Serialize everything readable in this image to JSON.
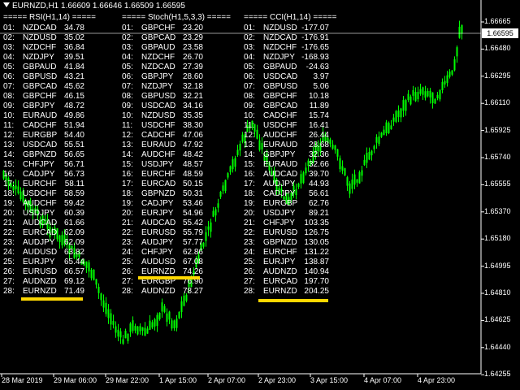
{
  "title": "EURNZD,H1  1.66609 1.66646 1.66509 1.66595",
  "columns": [
    {
      "header": "===== RSI(H1,14) =====",
      "rows": [
        [
          "01:",
          "NZDCAD",
          "34.78"
        ],
        [
          "02:",
          "NZDUSD",
          "35.02"
        ],
        [
          "03:",
          "NZDCHF",
          "36.84"
        ],
        [
          "04:",
          "NZDJPY",
          "39.51"
        ],
        [
          "05:",
          "GBPAUD",
          "41.84"
        ],
        [
          "06:",
          "GBPUSD",
          "43.21"
        ],
        [
          "07:",
          "GBPCAD",
          "45.62"
        ],
        [
          "08:",
          "GBPCHF",
          "46.15"
        ],
        [
          "09:",
          "GBPJPY",
          "48.72"
        ],
        [
          "10:",
          "EURAUD",
          "49.86"
        ],
        [
          "11:",
          "CADCHF",
          "51.94"
        ],
        [
          "12:",
          "EURGBP",
          "54.40"
        ],
        [
          "13:",
          "USDCAD",
          "55.51"
        ],
        [
          "14:",
          "GBPNZD",
          "56.65"
        ],
        [
          "15:",
          "CHFJPY",
          "56.71"
        ],
        [
          "16:",
          "CADJPY",
          "56.73"
        ],
        [
          "17:",
          "EURCHF",
          "58.11"
        ],
        [
          "18:",
          "USDCHF",
          "58.59"
        ],
        [
          "19:",
          "AUDCHF",
          "59.42"
        ],
        [
          "20:",
          "USDJPY",
          "60.39"
        ],
        [
          "21:",
          "AUDCAD",
          "61.66"
        ],
        [
          "22:",
          "EURCAD",
          "62.09"
        ],
        [
          "23:",
          "AUDJPY",
          "62.09"
        ],
        [
          "24:",
          "AUDUSD",
          "63.82"
        ],
        [
          "25:",
          "EURJPY",
          "65.44"
        ],
        [
          "26:",
          "EURUSD",
          "66.57"
        ],
        [
          "27:",
          "AUDNZD",
          "69.12"
        ],
        [
          "28:",
          "EURNZD",
          "71.49"
        ]
      ]
    },
    {
      "header": "===== Stoch(H1,5,3,3) =====",
      "rows": [
        [
          "01:",
          "GBPCHF",
          "23.20"
        ],
        [
          "02:",
          "GBPCAD",
          "23.29"
        ],
        [
          "03:",
          "GBPAUD",
          "23.58"
        ],
        [
          "04:",
          "NZDCHF",
          "26.70"
        ],
        [
          "05:",
          "NZDCAD",
          "27.39"
        ],
        [
          "06:",
          "GBPJPY",
          "28.60"
        ],
        [
          "07:",
          "NZDJPY",
          "32.18"
        ],
        [
          "08:",
          "GBPUSD",
          "32.21"
        ],
        [
          "09:",
          "USDCAD",
          "34.16"
        ],
        [
          "10:",
          "NZDUSD",
          "35.35"
        ],
        [
          "11:",
          "USDCHF",
          "38.30"
        ],
        [
          "12:",
          "CADCHF",
          "47.06"
        ],
        [
          "13:",
          "EURAUD",
          "47.92"
        ],
        [
          "14:",
          "AUDCHF",
          "48.42"
        ],
        [
          "15:",
          "USDJPY",
          "48.57"
        ],
        [
          "16:",
          "EURCHF",
          "48.59"
        ],
        [
          "17:",
          "EURCAD",
          "50.15"
        ],
        [
          "18:",
          "GBPNZD",
          "50.31"
        ],
        [
          "19:",
          "CADJPY",
          "53.46"
        ],
        [
          "20:",
          "EURJPY",
          "54.96"
        ],
        [
          "21:",
          "AUDCAD",
          "55.42"
        ],
        [
          "22:",
          "EURUSD",
          "55.79"
        ],
        [
          "23:",
          "AUDJPY",
          "57.77"
        ],
        [
          "24:",
          "CHFJPY",
          "62.86"
        ],
        [
          "25:",
          "AUDUSD",
          "67.08"
        ],
        [
          "26:",
          "EURNZD",
          "74.26"
        ],
        [
          "27:",
          "EURGBP",
          "76.90"
        ],
        [
          "28:",
          "AUDNZD",
          "78.27"
        ]
      ]
    },
    {
      "header": "===== CCI(H1,14) =====",
      "rows": [
        [
          "01:",
          "NZDUSD",
          "-177.07"
        ],
        [
          "02:",
          "NZDCAD",
          "-176.91"
        ],
        [
          "03:",
          "NZDCHF",
          "-176.65"
        ],
        [
          "04:",
          "NZDJPY",
          "-168.93"
        ],
        [
          "05:",
          "GBPAUD",
          "-24.63"
        ],
        [
          "06:",
          "USDCAD",
          "3.97"
        ],
        [
          "07:",
          "GBPUSD",
          "5.06"
        ],
        [
          "08:",
          "GBPCHF",
          "10.18"
        ],
        [
          "09:",
          "GBPCAD",
          "11.89"
        ],
        [
          "10:",
          "CADCHF",
          "15.74"
        ],
        [
          "11:",
          "USDCHF",
          "16.41"
        ],
        [
          "12:",
          "AUDCHF",
          "26.44"
        ],
        [
          "13:",
          "EURAUD",
          "28.68"
        ],
        [
          "14:",
          "GBPJPY",
          "32.36"
        ],
        [
          "15:",
          "EURAUD",
          "32.66"
        ],
        [
          "16:",
          "AUDCAD",
          "39.70"
        ],
        [
          "17:",
          "AUDJPY",
          "44.93"
        ],
        [
          "18:",
          "CADJPY",
          "56.61"
        ],
        [
          "19:",
          "EURGBP",
          "62.76"
        ],
        [
          "20:",
          "USDJPY",
          "89.21"
        ],
        [
          "21:",
          "CHFJPY",
          "103.35"
        ],
        [
          "22:",
          "EURUSD",
          "126.75"
        ],
        [
          "23:",
          "GBPNZD",
          "130.05"
        ],
        [
          "24:",
          "EURCHF",
          "131.22"
        ],
        [
          "25:",
          "EURJPY",
          "138.87"
        ],
        [
          "26:",
          "AUDNZD",
          "140.94"
        ],
        [
          "27:",
          "EURCAD",
          "197.70"
        ],
        [
          "28:",
          "EURNZD",
          "204.25"
        ]
      ]
    }
  ],
  "price_axis": [
    "1.66665",
    "1.66480",
    "1.66295",
    "1.66110",
    "1.65925",
    "1.65740",
    "1.65555",
    "1.65370",
    "1.65180",
    "1.64995",
    "1.64810",
    "1.64625",
    "1.64440",
    "1.64255"
  ],
  "current_price": "1.66595",
  "time_axis": [
    "28 Mar 2019",
    "29 Mar 06:00",
    "29 Mar 22:00",
    "1 Apr 15:00",
    "2 Apr 07:00",
    "2 Apr 23:00",
    "3 Apr 15:00",
    "4 Apr 07:00",
    "4 Apr 23:00"
  ],
  "colors": {
    "background": "#000000",
    "candle": "#00ff00",
    "highlight": "#ffd800",
    "text": "#ffffff"
  }
}
